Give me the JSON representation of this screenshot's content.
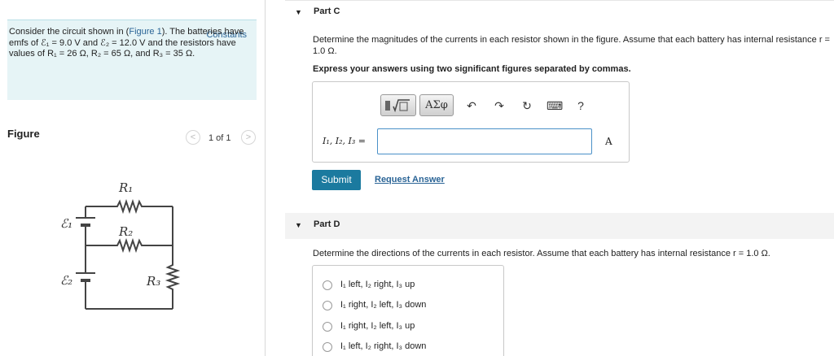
{
  "problem": {
    "constants_link": "Constants",
    "text_pre": "Consider the circuit shown in (",
    "figure_link": "Figure 1",
    "text_post": "). The batteries have emfs of ℰ₁ = 9.0 V and ℰ₂ = 12.0 V and the resistors have values of R₁ = 26 Ω, R₂ = 65 Ω, and R₃ = 35 Ω."
  },
  "figure": {
    "label": "Figure",
    "prev_icon": "chevron-left-icon",
    "next_icon": "chevron-right-icon",
    "prev_glyph": "<",
    "next_glyph": ">",
    "counter": "1 of 1",
    "labels": {
      "r1": "R₁",
      "r2": "R₂",
      "r3": "R₃",
      "e1": "ℰ₁",
      "e2": "ℰ₂"
    }
  },
  "partC": {
    "title": "Part C",
    "question": "Determine the magnitudes of the currents in each resistor shown in the figure. Assume that each battery has internal resistance r = 1.0 Ω.",
    "instructions": "Express your answers using two significant figures separated by commas.",
    "answer_label": "I₁, I₂, I₃ =",
    "answer_value": "",
    "unit": "A",
    "submit_label": "Submit",
    "request_label": "Request Answer",
    "toolbar": {
      "template_icon": "template-icon",
      "greek_label": "ΑΣφ",
      "undo_glyph": "↶",
      "redo_glyph": "↷",
      "reset_glyph": "↻",
      "keyboard_glyph": "⌨",
      "help_glyph": "?"
    }
  },
  "partD": {
    "title": "Part D",
    "question": "Determine the directions of the currents in each resistor. Assume that each battery has internal resistance r = 1.0 Ω.",
    "options": [
      "I₁ left, I₂ right, I₃ up",
      "I₁ right, I₂ left, I₃ down",
      "I₁ right, I₂ left, I₃ up",
      "I₁ left, I₂ right, I₃ down"
    ]
  },
  "colors": {
    "accent": "#1b7a9f",
    "link": "#2a6496",
    "panel_bg": "#e6f4f6"
  }
}
